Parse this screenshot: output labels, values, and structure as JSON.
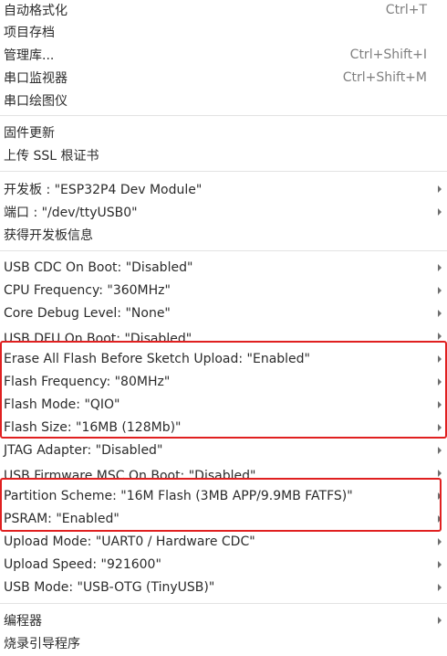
{
  "menu": {
    "group1": [
      {
        "label": "自动格式化",
        "shortcut": "Ctrl+T"
      },
      {
        "label": "项目存档",
        "shortcut": ""
      },
      {
        "label": "管理库...",
        "shortcut": "Ctrl+Shift+I"
      },
      {
        "label": "串口监视器",
        "shortcut": "Ctrl+Shift+M"
      },
      {
        "label": "串口绘图仪",
        "shortcut": ""
      }
    ],
    "group2": [
      {
        "label": "固件更新"
      },
      {
        "label": "上传 SSL 根证书"
      }
    ],
    "group3": [
      {
        "label": "开发板 : \"ESP32P4 Dev Module\""
      },
      {
        "label": "端口 : \"/dev/ttyUSB0\""
      },
      {
        "label": "获得开发板信息"
      }
    ],
    "group4": [
      {
        "label": "USB CDC On Boot: \"Disabled\""
      },
      {
        "label": "CPU Frequency: \"360MHz\""
      },
      {
        "label": "Core Debug Level: \"None\""
      },
      {
        "label": "USB DFU On Boot: \"Disabled\""
      },
      {
        "label": "Erase All Flash Before Sketch Upload: \"Enabled\""
      },
      {
        "label": "Flash Frequency: \"80MHz\""
      },
      {
        "label": "Flash Mode: \"QIO\""
      },
      {
        "label": "Flash Size: \"16MB (128Mb)\""
      },
      {
        "label": "JTAG Adapter: \"Disabled\""
      },
      {
        "label": "USB Firmware MSC On Boot: \"Disabled\""
      },
      {
        "label": "Partition Scheme: \"16M Flash (3MB APP/9.9MB FATFS)\""
      },
      {
        "label": "PSRAM: \"Enabled\""
      },
      {
        "label": "Upload Mode: \"UART0 / Hardware CDC\""
      },
      {
        "label": "Upload Speed: \"921600\""
      },
      {
        "label": "USB Mode: \"USB-OTG (TinyUSB)\""
      }
    ],
    "group5": [
      {
        "label": "编程器"
      },
      {
        "label": "烧录引导程序"
      }
    ]
  },
  "highlight_color": "#e02020"
}
